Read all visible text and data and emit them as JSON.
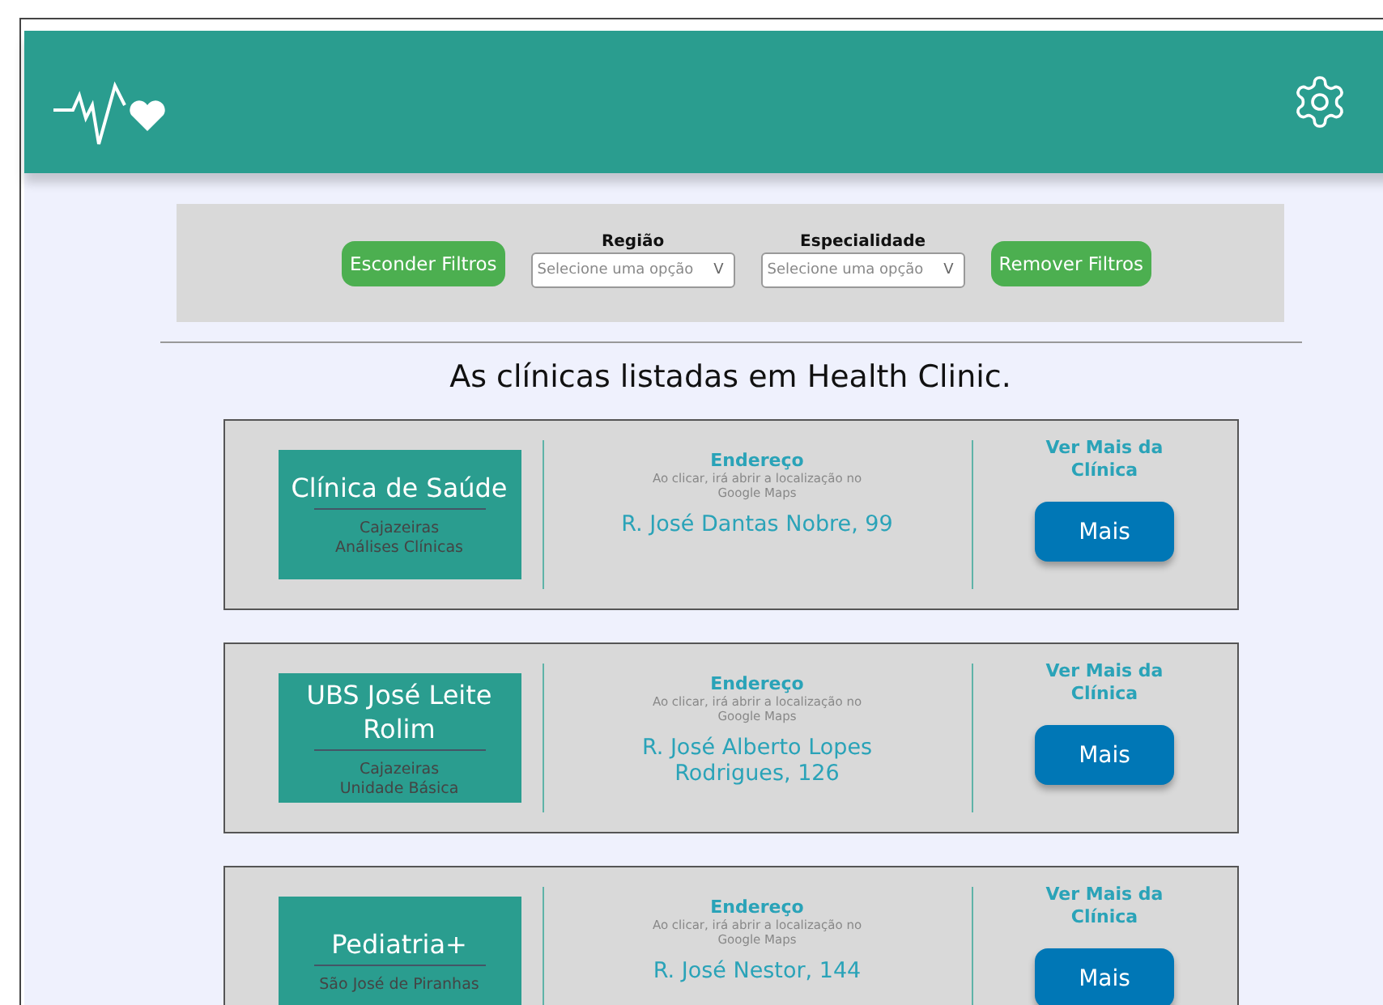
{
  "header": {
    "kind": "logo-and-settings"
  },
  "filters": {
    "hide_button": "Esconder Filtros",
    "remove_button": "Remover Filtros",
    "selects": [
      {
        "label": "Região",
        "placeholder": "Selecione uma opção",
        "caret": "V"
      },
      {
        "label": "Especialidade",
        "placeholder": "Selecione uma opção",
        "caret": "V"
      }
    ]
  },
  "title": "As clínicas listadas em Health Clinic.",
  "clinics": [
    {
      "name": "Clínica de Saúde",
      "details": [
        "Cajazeiras",
        "Análises Clínicas"
      ],
      "address_label": "Endereço",
      "address_hint": "Ao clicar, irá abrir a localização no Google Maps",
      "address": "R. José Dantas Nobre, 99",
      "more_label": "Ver Mais da Clínica",
      "more_button": "Mais"
    },
    {
      "name": "UBS José Leite Rolim",
      "details": [
        "Cajazeiras",
        "Unidade Básica"
      ],
      "address_label": "Endereço",
      "address_hint": "Ao clicar, irá abrir a localização no Google Maps",
      "address": "R. José Alberto Lopes Rodrigues, 126",
      "more_label": "Ver Mais da Clínica",
      "more_button": "Mais"
    },
    {
      "name": "Pediatria+",
      "details": [
        "São José de Piranhas"
      ],
      "address_label": "Endereço",
      "address_hint": "Ao clicar, irá abrir a localização no Google Maps",
      "address": "R. José Nestor, 144",
      "more_label": "Ver Mais da Clínica",
      "more_button": "Mais"
    }
  ]
}
